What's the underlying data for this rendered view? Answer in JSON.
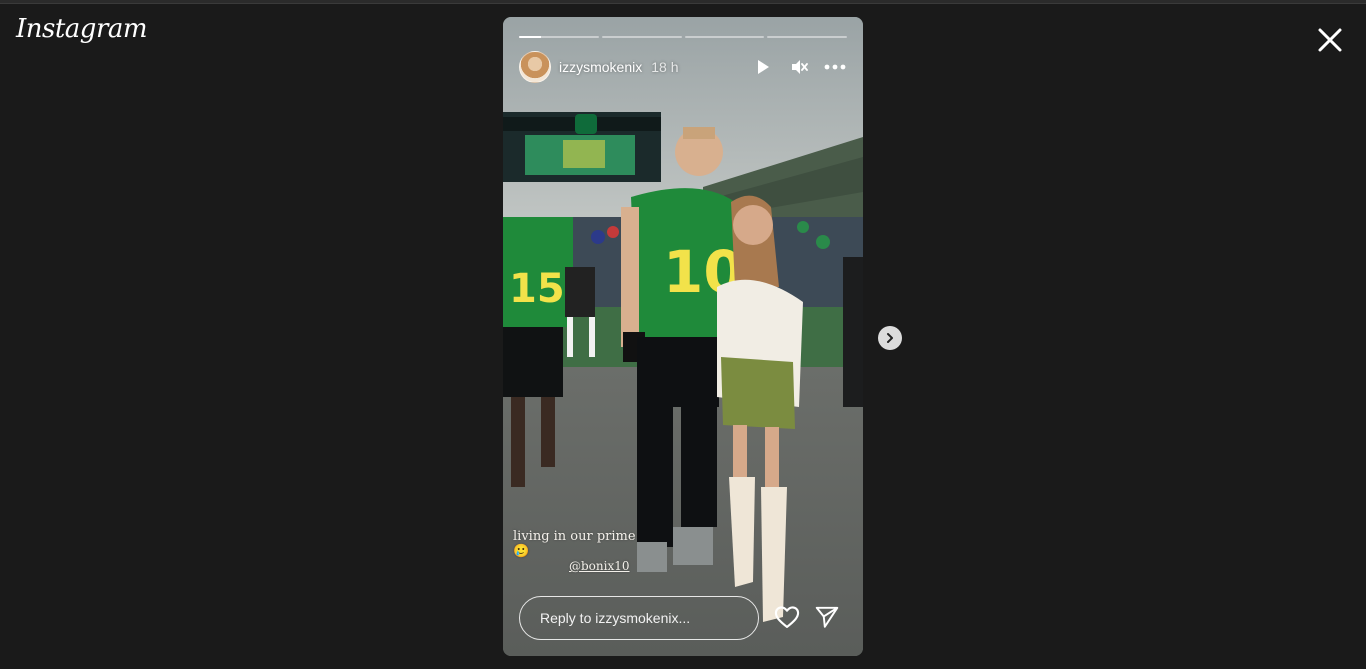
{
  "app": {
    "logo_text": "Instagram"
  },
  "story": {
    "username": "izzysmokenix",
    "time_ago": "18 h",
    "segments_total": 4,
    "active_segment": 1,
    "active_segment_progress": 0.28,
    "caption_line": "living in our prime 🥲",
    "caption_mention": "@bonix10",
    "reply_placeholder": "Reply to izzysmokenix..."
  },
  "icons": {
    "close": "close-icon",
    "play": "play-icon",
    "mute": "muted-speaker-icon",
    "more": "more-options-icon",
    "like": "heart-icon",
    "share": "paper-plane-icon",
    "next": "chevron-right-icon"
  },
  "colors": {
    "page_background": "#1a1a1a",
    "team_green": "#1f8a3a",
    "team_yellow": "#f2e24a"
  }
}
